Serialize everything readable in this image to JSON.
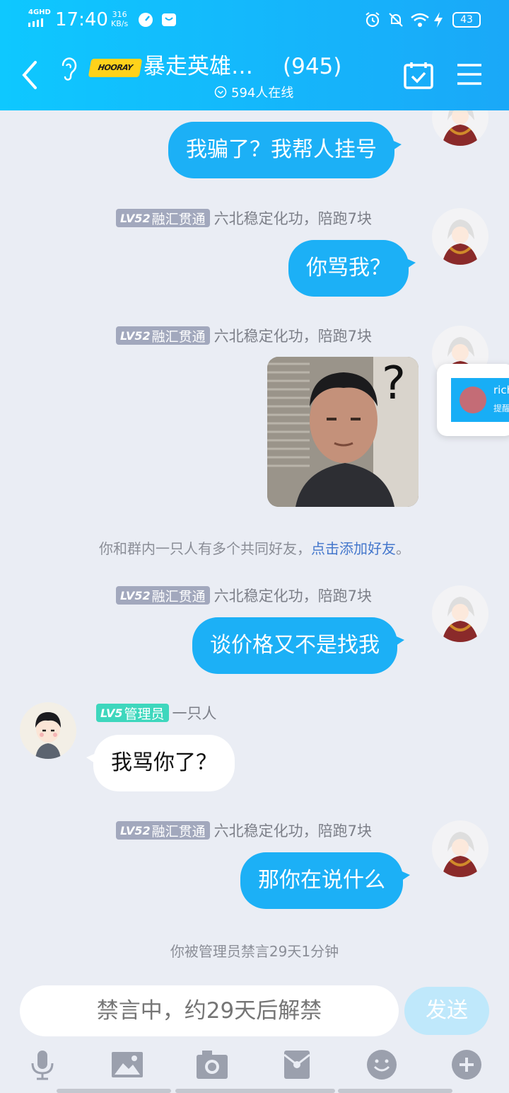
{
  "status_bar": {
    "network": "4GHD",
    "time": "17:40",
    "speed_value": "316",
    "speed_unit": "KB/s",
    "battery": "43"
  },
  "header": {
    "logo_text": "HOORAY",
    "title": "暴走英雄…",
    "member_count": "(945)",
    "online": "594人在线"
  },
  "messages": [
    {
      "kind": "out",
      "text": "我骗了？我帮人挂号"
    },
    {
      "kind": "out",
      "level": "LV52",
      "title": "融汇贯通",
      "nick": "六北稳定化功，陪跑7块",
      "text": "你骂我？"
    },
    {
      "kind": "out_image",
      "level": "LV52",
      "title": "融汇贯通",
      "nick": "六北稳定化功，陪跑7块",
      "image_mark": "?"
    },
    {
      "kind": "system",
      "text": "你和群内一只人有多个共同好友，",
      "link": "点击添加好友",
      "suffix": "。"
    },
    {
      "kind": "out",
      "level": "LV52",
      "title": "融汇贯通",
      "nick": "六北稳定化功，陪跑7块",
      "text": "谈价格又不是找我"
    },
    {
      "kind": "in",
      "level": "LV5",
      "title": "管理员",
      "nick": "一只人",
      "text": "我骂你了？"
    },
    {
      "kind": "out",
      "level": "LV52",
      "title": "融汇贯通",
      "nick": "六北稳定化功，陪跑7块",
      "text": "那你在说什么"
    },
    {
      "kind": "system",
      "text": "你被管理员禁言29天1分钟"
    }
  ],
  "toast": {
    "name": "rich",
    "sub": "提醒"
  },
  "input": {
    "placeholder": "禁言中，约29天后解禁",
    "send_label": "发送"
  },
  "colors": {
    "accent": "#1cb0f6",
    "admin_badge": "#3ed7bd",
    "level_badge": "#a2a8bd"
  },
  "toolbar_icons": [
    "microphone-icon",
    "image-icon",
    "camera-icon",
    "red-packet-icon",
    "emoji-icon",
    "plus-icon"
  ]
}
